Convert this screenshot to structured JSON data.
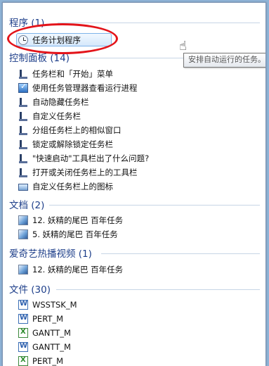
{
  "groups": {
    "programs": {
      "header": "程序 (1)",
      "items": [
        "任务计划程序"
      ]
    },
    "control_panel": {
      "header": "控制面板 (14)",
      "items": [
        "任务栏和「开始」菜单",
        "使用任务管理器查看运行进程",
        "自动隐藏任务栏",
        "自定义任务栏",
        "分组任务栏上的相似窗口",
        "锁定或解除锁定任务栏",
        "\"快速启动\"工具栏出了什么问题?",
        "打开或关闭任务栏上的工具栏",
        "自定义任务栏上的图标"
      ]
    },
    "documents": {
      "header": "文档 (2)",
      "items": [
        "12. 妖精的尾巴 百年任务",
        "5. 妖精的尾巴 百年任务"
      ]
    },
    "iqiyi": {
      "header": "爱奇艺热播视频 (1)",
      "items": [
        "12. 妖精的尾巴 百年任务"
      ]
    },
    "files": {
      "header": "文件 (30)",
      "items": [
        "WSSTSK_M",
        "PERT_M",
        "GANTT_M",
        "GANTT_M",
        "PERT_M"
      ]
    }
  },
  "tooltip": "安排自动运行的任务。",
  "icons": {
    "task_scheduler": "clock-icon",
    "taskbar": "taskbar-icon",
    "task_manager": "monitor-check-icon",
    "custom_icons": "laptop-icon",
    "video": "movie-icon",
    "word": "word-doc-icon",
    "excel": "excel-doc-icon"
  },
  "colors": {
    "header_text": "#1e3f8a",
    "highlight_oval": "#e3141a",
    "selection_border": "#7eb4ea"
  }
}
